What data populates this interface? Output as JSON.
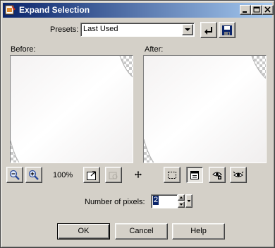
{
  "window": {
    "title": "Expand Selection"
  },
  "presets": {
    "label": "Presets:",
    "selected": "Last Used"
  },
  "preview": {
    "before_label": "Before:",
    "after_label": "After:"
  },
  "zoom": {
    "level": "100%"
  },
  "fields": {
    "pixels_label": "Number of pixels:",
    "pixels_value": "2"
  },
  "buttons": {
    "ok": "OK",
    "cancel": "Cancel",
    "help": "Help"
  },
  "icons": {
    "app": "app-icon",
    "minimize": "minimize-icon",
    "maximize": "maximize-icon",
    "close": "close-icon",
    "dropdown": "chevron-down-icon",
    "reset": "reset-arrow-icon",
    "save": "save-disk-icon",
    "zoom_out": "zoom-out-icon",
    "zoom_in": "zoom-in-icon",
    "fit": "zoom-fit-icon",
    "locator": "locator-icon",
    "pan": "pan-crosshair-icon",
    "marquee": "marquee-icon",
    "proof": "proof-icon",
    "auto_proof": "auto-proof-icon",
    "preview": "preview-eye-icon"
  },
  "colors": {
    "title_start": "#0a246a",
    "title_end": "#a6caf0",
    "face": "#d4d0c8"
  }
}
